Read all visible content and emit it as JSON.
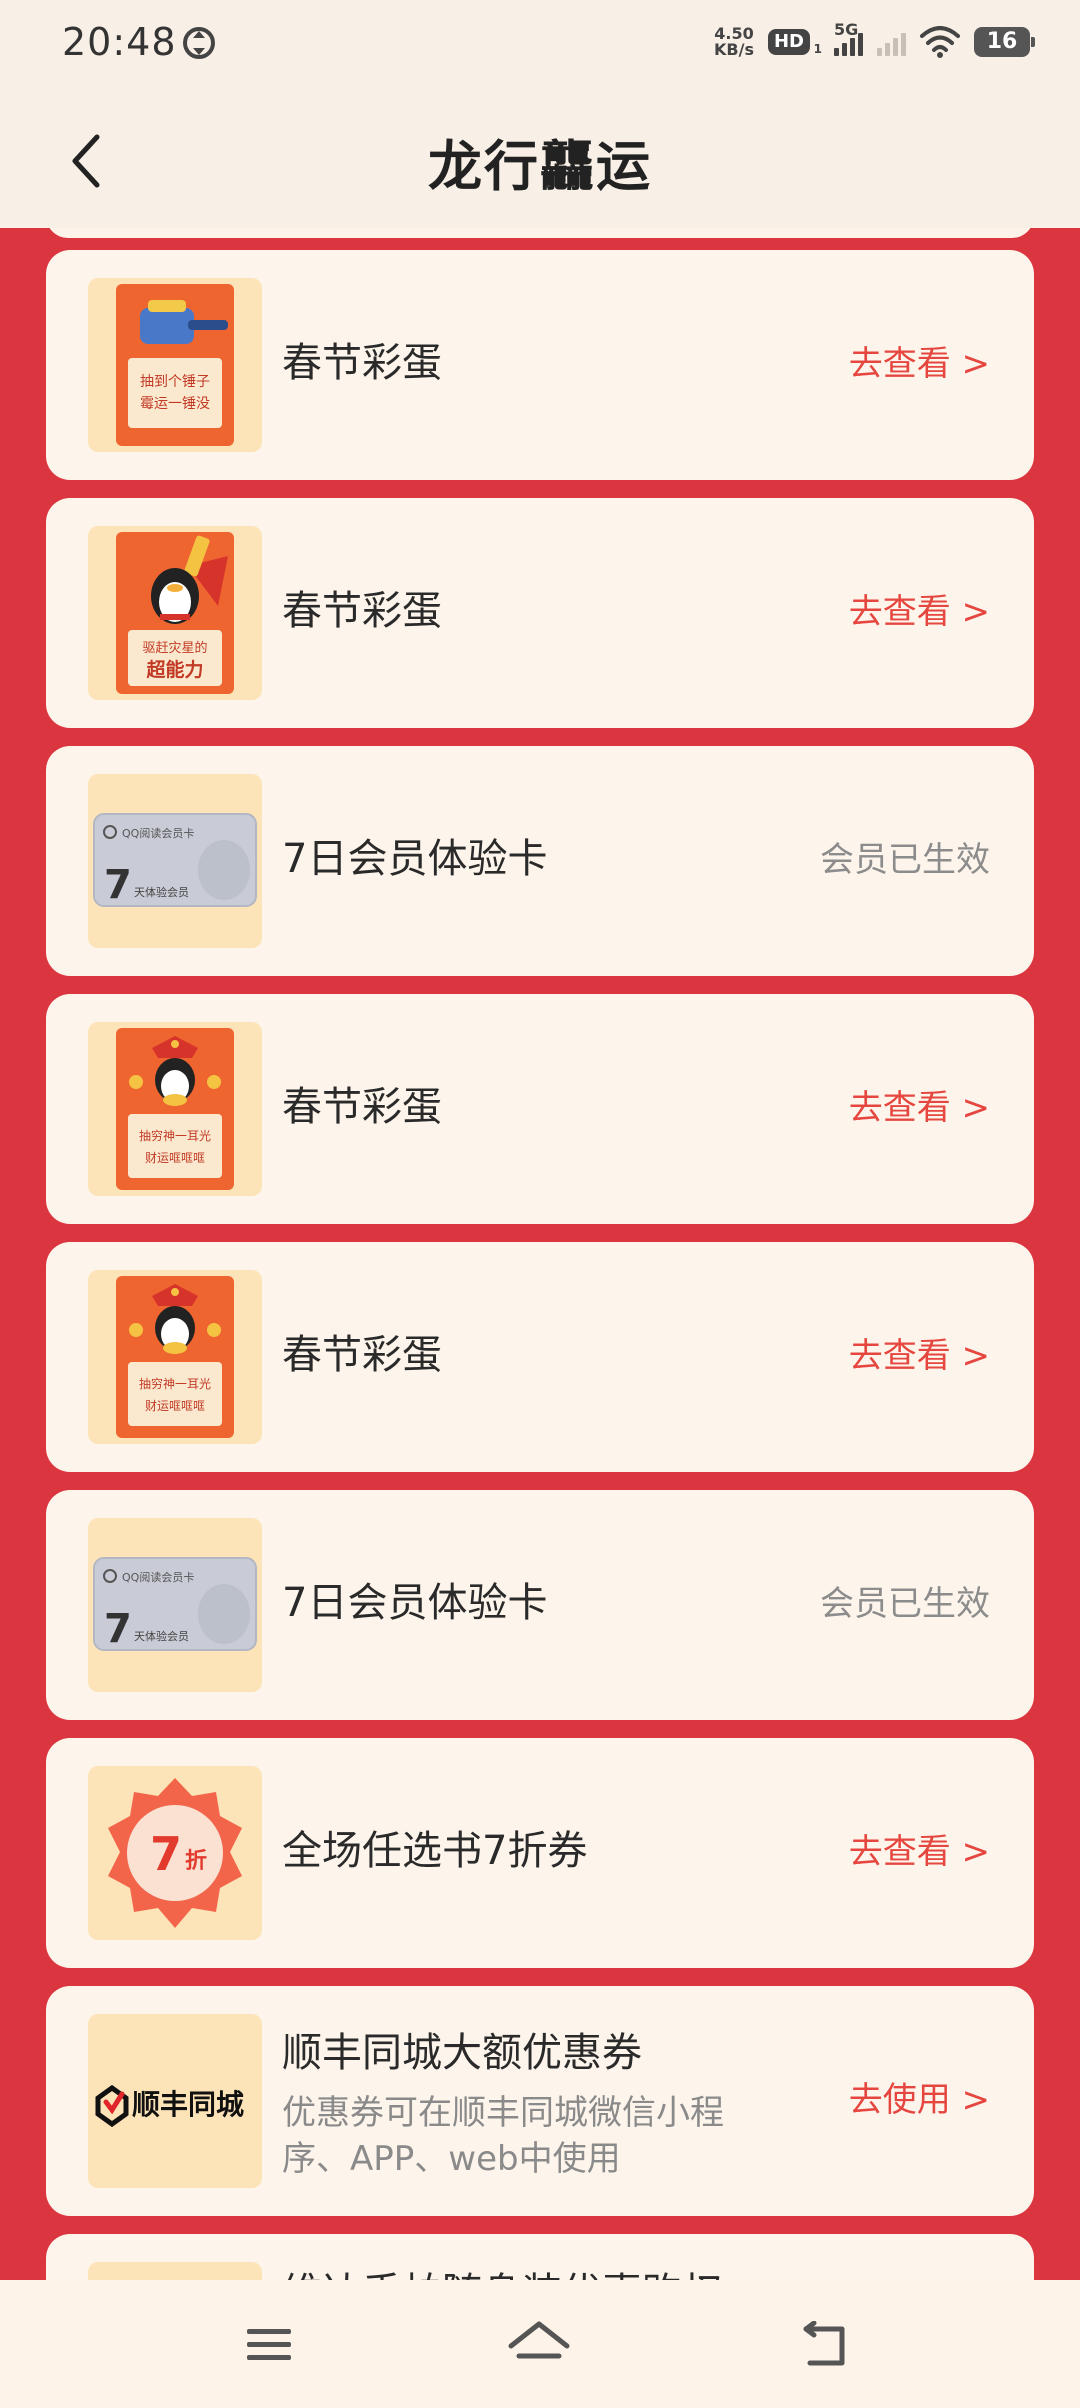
{
  "status_bar": {
    "time": "20:48",
    "net_speed_value": "4.50",
    "net_speed_unit": "KB/s",
    "hd_label": "HD",
    "hd_sub": "1",
    "network_type": "5G",
    "battery": "16"
  },
  "header": {
    "title": "龙行龘运"
  },
  "thumbs": {
    "hammer_line1": "抽到个锤子",
    "hammer_line2": "霉运一锤没",
    "power_line1": "驱赶灾星的",
    "power_line2": "超能力",
    "card_brand": "QQ阅读会员卡",
    "card_days": "7",
    "card_sub": "天体验会员",
    "fortune_line1": "抽穷神一耳光",
    "fortune_line2": "财运哐哐哐",
    "discount_num": "7",
    "discount_unit": "折",
    "sf_brand": "顺丰同城"
  },
  "cards": [
    {
      "title": "春节彩蛋",
      "action": "去查看 >"
    },
    {
      "title": "春节彩蛋",
      "action": "去查看 >"
    },
    {
      "title": "7日会员体验卡",
      "action": "会员已生效"
    },
    {
      "title": "春节彩蛋",
      "action": "去查看 >"
    },
    {
      "title": "春节彩蛋",
      "action": "去查看 >"
    },
    {
      "title": "7日会员体验卡",
      "action": "会员已生效"
    },
    {
      "title": "全场任选书7折券",
      "action": "去查看 >"
    },
    {
      "title": "顺丰同城大额优惠券",
      "desc": "优惠券可在顺丰同城微信小程序、APP、web中使用",
      "action": "去使用 >"
    },
    {
      "title": "维达手帕随身装优惠购权"
    }
  ],
  "colors": {
    "accent_red": "#db3540",
    "action_red": "#e5463f",
    "card_bg": "#fdf5ec",
    "thumb_bg": "#fde4b8"
  }
}
